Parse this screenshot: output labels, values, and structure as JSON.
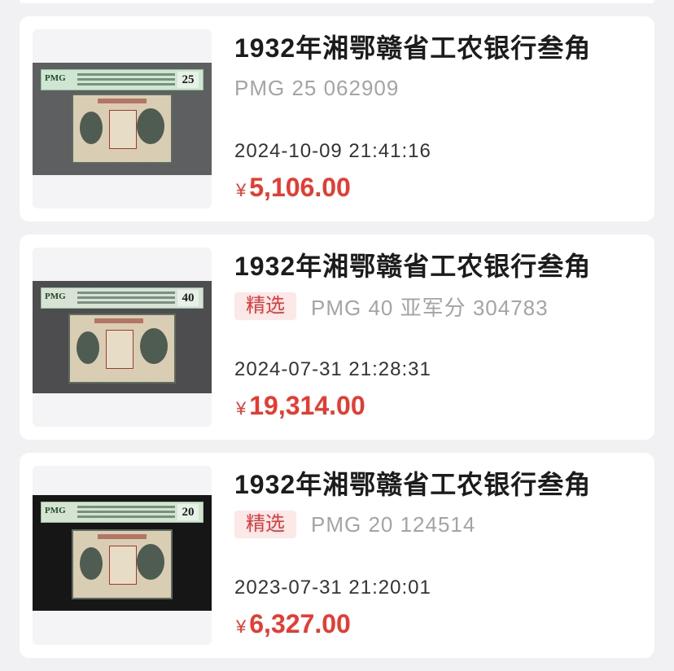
{
  "listings": [
    {
      "title": "1932年湘鄂赣省工农银行叁角",
      "badge": "",
      "grade_text": "PMG 25 062909",
      "date": "2024-10-09 21:41:16",
      "currency_symbol": "¥",
      "price": "5,106.00",
      "slab_grade": "25",
      "slab_logo": "PMG"
    },
    {
      "title": "1932年湘鄂赣省工农银行叁角",
      "badge": "精选",
      "grade_text": "PMG 40 亚军分 304783",
      "date": "2024-07-31 21:28:31",
      "currency_symbol": "¥",
      "price": "19,314.00",
      "slab_grade": "40",
      "slab_logo": "PMG"
    },
    {
      "title": "1932年湘鄂赣省工农银行叁角",
      "badge": "精选",
      "grade_text": "PMG 20 124514",
      "date": "2023-07-31 21:20:01",
      "currency_symbol": "¥",
      "price": "6,327.00",
      "slab_grade": "20",
      "slab_logo": "PMG"
    }
  ],
  "colors": {
    "page_bg": "#f1f1f3",
    "card_bg": "#ffffff",
    "price": "#ea3a30",
    "badge_bg": "#fde8e8",
    "badge_text": "#e23a3a",
    "muted_text": "#a4a4a8"
  }
}
